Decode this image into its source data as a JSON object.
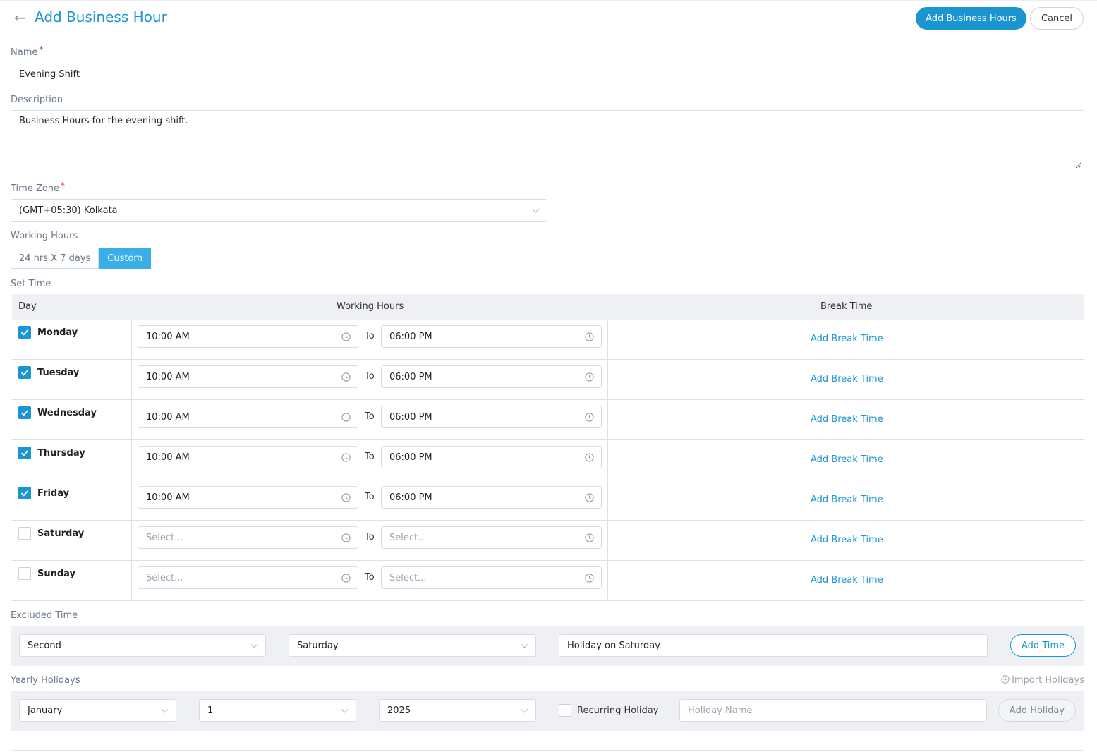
{
  "header": {
    "back_icon": "arrow-left-icon",
    "title": "Add Business Hour",
    "primary_label": "Add Business Hours",
    "cancel_label": "Cancel"
  },
  "form": {
    "name_label": "Name",
    "name_value": "Evening Shift",
    "description_label": "Description",
    "description_value": "Business Hours for the evening shift.",
    "timezone_label": "Time Zone",
    "timezone_value": "(GMT+05:30) Kolkata",
    "required_mark": "*"
  },
  "working_hours": {
    "label": "Working Hours",
    "options": [
      "24 hrs X 7 days",
      "Custom"
    ],
    "selected": "Custom"
  },
  "set_time": {
    "label": "Set Time",
    "columns": [
      "Day",
      "Working Hours",
      "Break Time"
    ],
    "to_label": "To",
    "break_link": "Add Break Time",
    "placeholder": "Select...",
    "days": [
      {
        "day": "Monday",
        "checked": true,
        "from": "10:00 AM",
        "to": "06:00 PM"
      },
      {
        "day": "Tuesday",
        "checked": true,
        "from": "10:00 AM",
        "to": "06:00 PM"
      },
      {
        "day": "Wednesday",
        "checked": true,
        "from": "10:00 AM",
        "to": "06:00 PM"
      },
      {
        "day": "Thursday",
        "checked": true,
        "from": "10:00 AM",
        "to": "06:00 PM"
      },
      {
        "day": "Friday",
        "checked": true,
        "from": "10:00 AM",
        "to": "06:00 PM"
      },
      {
        "day": "Saturday",
        "checked": false,
        "from": "",
        "to": ""
      },
      {
        "day": "Sunday",
        "checked": false,
        "from": "",
        "to": ""
      }
    ]
  },
  "excluded_time": {
    "label": "Excluded Time",
    "week": "Second",
    "weekday": "Saturday",
    "name": "Holiday on Saturday",
    "button": "Add Time"
  },
  "yearly_holidays": {
    "label": "Yearly Holidays",
    "import_label": "Import Holidays",
    "import_icon": "plus-circle-icon",
    "month": "January",
    "day": "1",
    "year": "2025",
    "recurring_label": "Recurring Holiday",
    "name_placeholder": "Holiday Name",
    "button": "Add Holiday"
  },
  "colors": {
    "accent": "#1a95d2",
    "segment_active": "#3aaee6",
    "required": "#e0312b",
    "panel": "#eef0f3"
  }
}
